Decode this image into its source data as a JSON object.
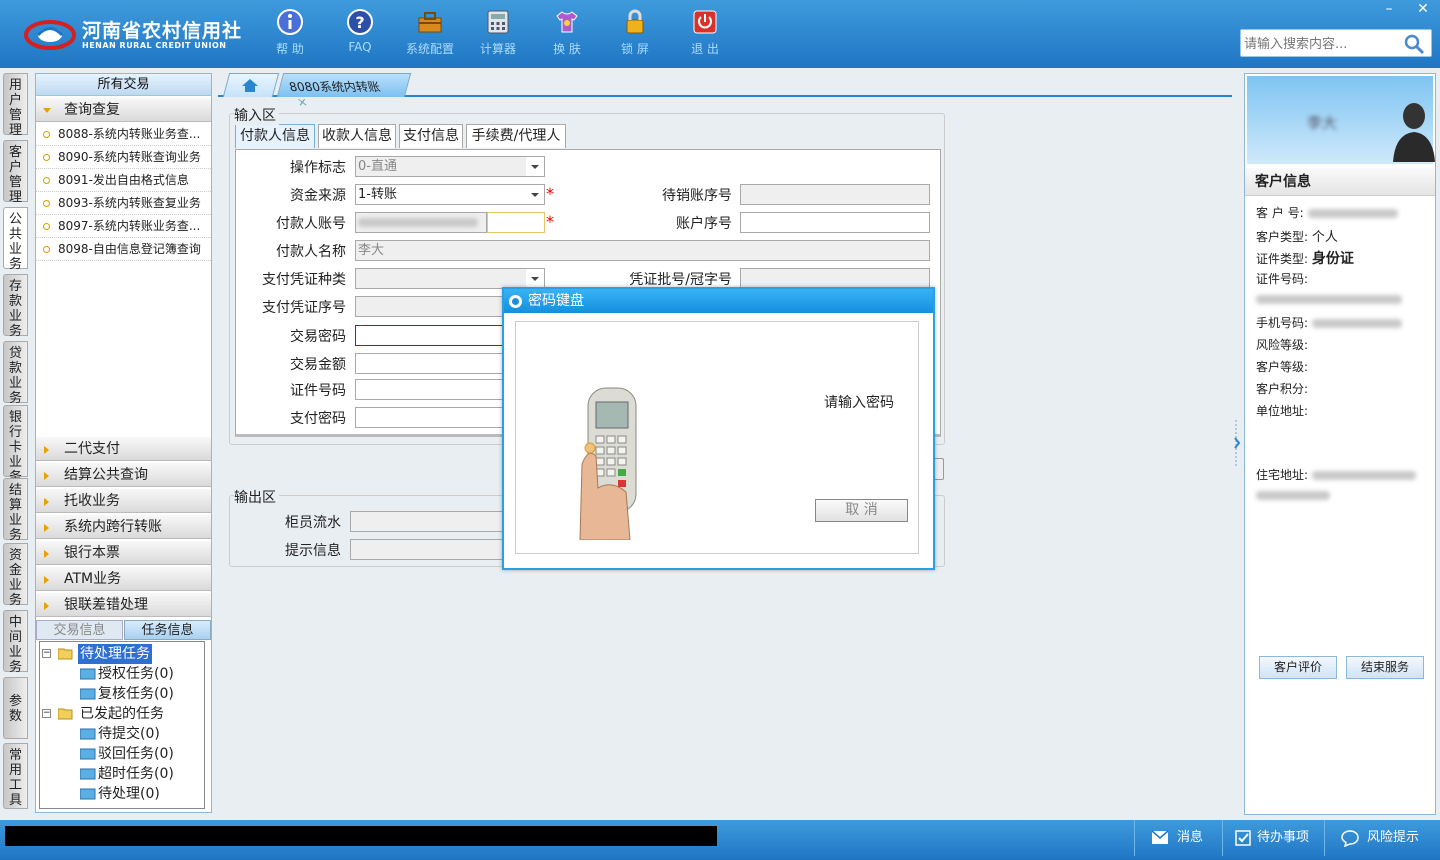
{
  "header": {
    "logo_cn": "河南省农村信用社",
    "logo_en": "HENAN RURAL CREDIT UNION",
    "toolbar": [
      {
        "label": "帮 助",
        "icon": "info-icon"
      },
      {
        "label": "FAQ",
        "icon": "question-icon"
      },
      {
        "label": "系统配置",
        "icon": "toolbox-icon"
      },
      {
        "label": "计算器",
        "icon": "calculator-icon"
      },
      {
        "label": "换 肤",
        "icon": "shirt-icon"
      },
      {
        "label": "锁 屏",
        "icon": "lock-icon"
      },
      {
        "label": "退 出",
        "icon": "power-icon"
      }
    ],
    "search_placeholder": "请输入搜索内容..."
  },
  "vtabs": [
    "用户管理",
    "客户管理",
    "公共业务",
    "存款业务",
    "贷款业务",
    "银行卡业务",
    "结算业务",
    "资金业务",
    "中间业务",
    "参数",
    "常用工具"
  ],
  "nav": {
    "title": "所有交易",
    "open_group": "查询查复",
    "items": [
      "8088-系统内转账业务查...",
      "8090-系统内转账查询业务",
      "8091-发出自由格式信息",
      "8093-系统内转账查复业务",
      "8097-系统内转账业务查...",
      "8098-自由信息登记簿查询"
    ],
    "groups": [
      "二代支付",
      "结算公共查询",
      "托收业务",
      "系统内跨行转账",
      "银行本票",
      "ATM业务",
      "银联差错处理"
    ],
    "subtabs": [
      "交易信息",
      "任务信息"
    ],
    "tree": {
      "pending": "待处理任务",
      "auth": "授权任务(0)",
      "review": "复核任务(0)",
      "initiated": "已发起的任务",
      "to_submit": "待提交(0)",
      "rejected": "驳回任务(0)",
      "timeout": "超时任务(0)",
      "to_process": "待处理(0)"
    }
  },
  "maintab": {
    "label": "8080系统内转账"
  },
  "form": {
    "input_area": "输入区",
    "tabs": [
      "付款人信息",
      "收款人信息",
      "支付信息",
      "手续费/代理人"
    ],
    "labels": {
      "op_flag": "操作标志",
      "fund_source": "资金来源",
      "payer_account": "付款人账号",
      "payer_name": "付款人名称",
      "voucher_type": "支付凭证种类",
      "voucher_seq": "支付凭证序号",
      "trade_pwd": "交易密码",
      "amount": "交易金额",
      "id_no": "证件号码",
      "pay_pwd": "支付密码",
      "pending_seq": "待销账序号",
      "acct_seq": "账户序号",
      "voucher_batch": "凭证批号/冠字号"
    },
    "values": {
      "op_flag": "0-直通",
      "fund_source": "1-转账",
      "payer_name": "李大"
    },
    "output_area": "输出区",
    "out_labels": {
      "teller_flow": "柜员流水",
      "hint": "提示信息"
    }
  },
  "dialog": {
    "title": "密码键盘",
    "prompt": "请输入密码",
    "cancel": "取 消"
  },
  "customer": {
    "name": "李大",
    "title": "客户信息",
    "fields": {
      "cust_no": "客 户 号:",
      "cust_type": "客户类型:",
      "cust_type_val": "个人",
      "id_type": "证件类型:",
      "id_type_val": "身份证",
      "id_no": "证件号码:",
      "phone": "手机号码:",
      "risk": "风险等级:",
      "level": "客户等级:",
      "points": "客户积分:",
      "unit_addr": "单位地址:",
      "home_addr": "住宅地址:"
    },
    "rate_btn": "客户评价",
    "end_btn": "结束服务"
  },
  "status": {
    "msg": "消息",
    "todo": "待办事项",
    "risk": "风险提示"
  },
  "colors": {
    "brand_blue": "#1f75c3",
    "required": "#e00000",
    "accent_orange": "#e7a000"
  }
}
